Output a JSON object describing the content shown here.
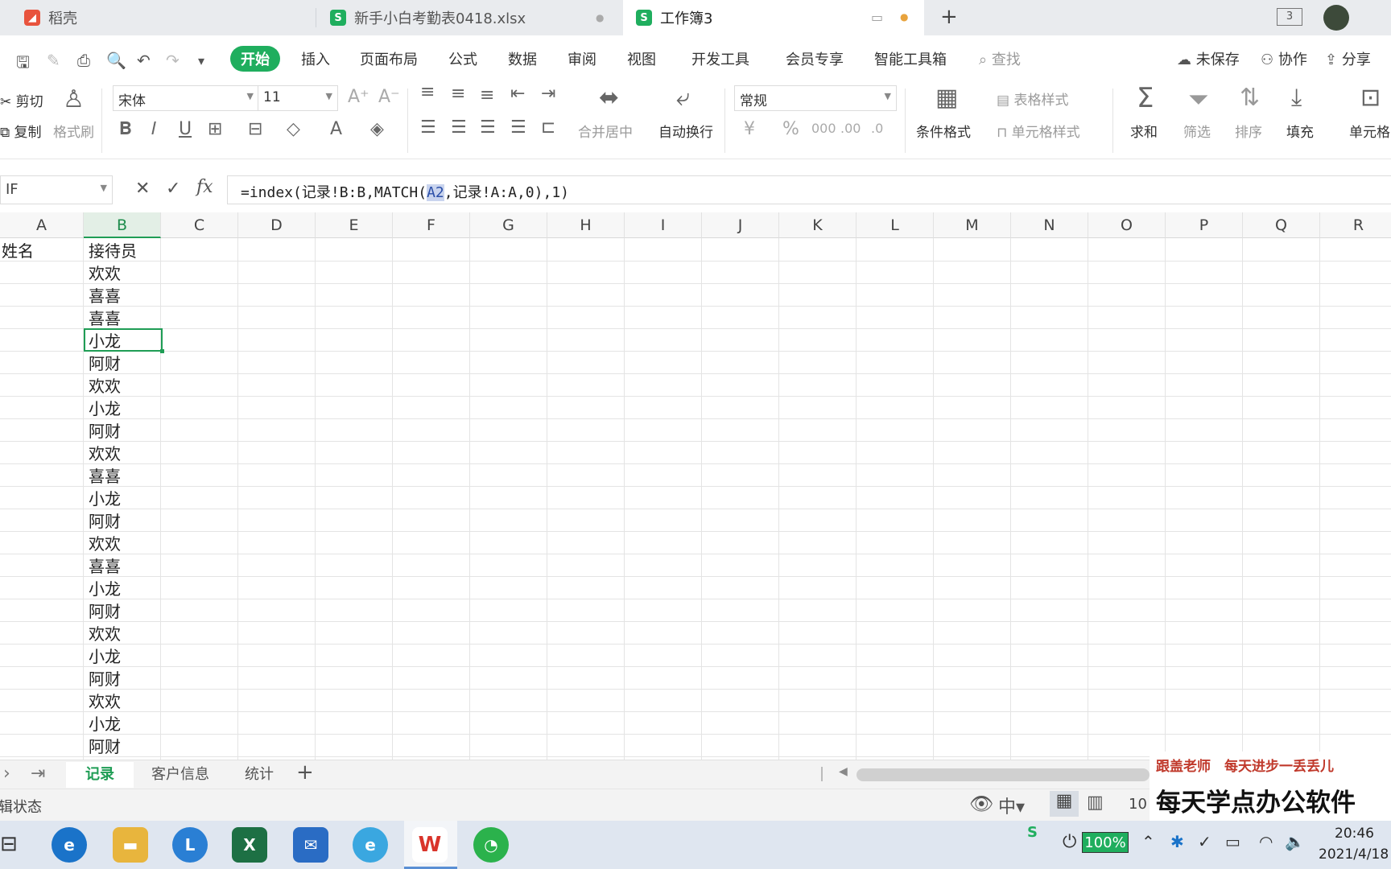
{
  "tabs": [
    {
      "label": "稻壳",
      "icon": "docer-icon",
      "color": "#e8533d"
    },
    {
      "label": "新手小白考勤表0418.xlsx",
      "icon": "spreadsheet-icon",
      "color": "#1fae5e"
    },
    {
      "label": "工作簿3",
      "icon": "spreadsheet-icon",
      "color": "#1fae5e"
    }
  ],
  "titlebar": {
    "window_count": "3"
  },
  "menu": {
    "items": [
      "开始",
      "插入",
      "页面布局",
      "公式",
      "数据",
      "审阅",
      "视图",
      "开发工具",
      "会员专享",
      "智能工具箱"
    ],
    "search": "查找",
    "unsaved": "未保存",
    "collab": "协作",
    "share": "分享"
  },
  "ribbon": {
    "cut": "剪切",
    "copy": "复制",
    "format_painter": "格式刷",
    "font": "宋体",
    "size": "11",
    "number_format": "常规",
    "merge": "合并居中",
    "wrap": "自动换行",
    "cond_format": "条件格式",
    "table_style": "表格样式",
    "cell_style": "单元格样式",
    "sum": "求和",
    "filter": "筛选",
    "sort": "排序",
    "fill": "填充",
    "cell": "单元格"
  },
  "formula_bar": {
    "name_box": "IF",
    "formula_prefix": "=index(记录!B:B,MATCH(",
    "formula_ref": "A2",
    "formula_suffix": ",记录!A:A,0),",
    "formula_end": "1)"
  },
  "grid": {
    "columns": [
      "A",
      "B",
      "C",
      "D",
      "E",
      "F",
      "G",
      "H",
      "I",
      "J",
      "K",
      "L",
      "M",
      "N",
      "O",
      "P",
      "Q",
      "R"
    ],
    "selected_column": "B",
    "header_row": {
      "A": "姓名",
      "B": "接待员"
    },
    "column_b": [
      "欢欢",
      "喜喜",
      "喜喜",
      "小龙",
      "阿财",
      "欢欢",
      "小龙",
      "阿财",
      "欢欢",
      "喜喜",
      "小龙",
      "阿财",
      "欢欢",
      "喜喜",
      "小龙",
      "阿财",
      "欢欢",
      "小龙",
      "阿财",
      "欢欢",
      "小龙",
      "阿财"
    ],
    "active_cell": "B5"
  },
  "sheets": {
    "tabs": [
      "记录",
      "客户信息",
      "统计"
    ],
    "active": "记录"
  },
  "status": {
    "mode": "编辑状态",
    "zoom": "10"
  },
  "watermark": {
    "line1": "跟盖老师　每天进步一丢丢儿",
    "line2": "每天学点办公软件"
  },
  "taskbar": {
    "battery": "100%",
    "time": "20:46",
    "date": "2021/4/18"
  }
}
